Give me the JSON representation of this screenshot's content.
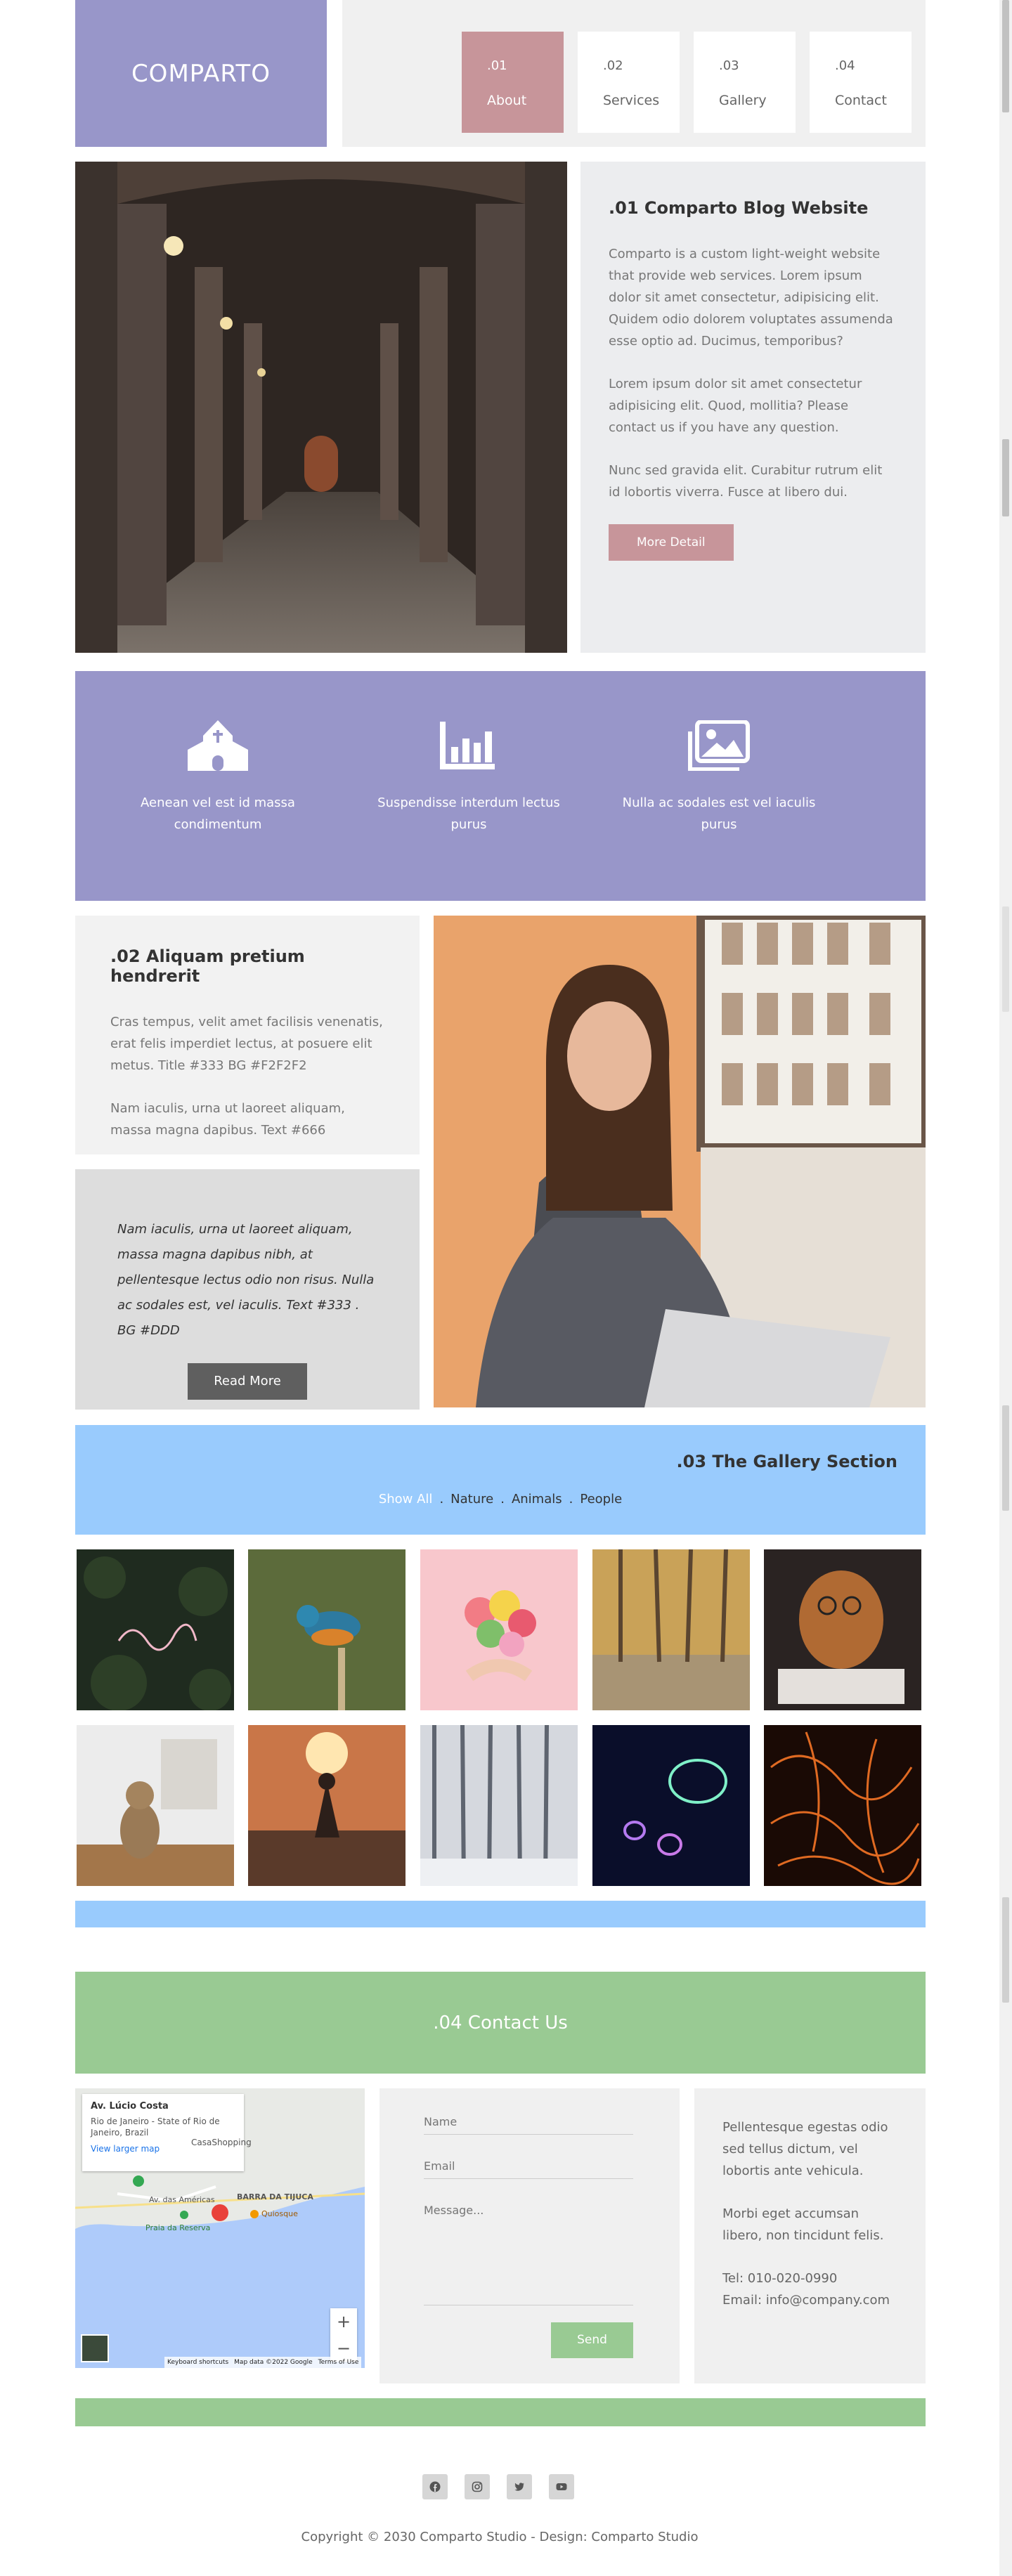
{
  "brand": {
    "logo": "COMPARTO"
  },
  "nav": [
    {
      "num": ".01",
      "label": "About",
      "active": true
    },
    {
      "num": ".02",
      "label": "Services",
      "active": false
    },
    {
      "num": ".03",
      "label": "Gallery",
      "active": false
    },
    {
      "num": ".04",
      "label": "Contact",
      "active": false
    }
  ],
  "about": {
    "title": ".01 Comparto Blog Website",
    "p1": "Comparto is a custom light-weight website that provide web services. Lorem ipsum dolor sit amet consectetur, adipisicing elit. Quidem odio dolorem voluptates assumenda esse optio ad. Ducimus, temporibus?",
    "p2": "Lorem ipsum dolor sit amet consectetur adipisicing elit. Quod, mollitia? Please contact us if you have any question.",
    "p3": "Nunc sed gravida elit. Curabitur rutrum elit id lobortis viverra. Fusce at libero dui.",
    "button": "More Detail"
  },
  "features": [
    {
      "icon": "church-icon",
      "text": "Aenean vel est id massa condimentum"
    },
    {
      "icon": "bar-chart-icon",
      "text": "Suspendisse interdum lectus purus"
    },
    {
      "icon": "images-icon",
      "text": "Nulla ac sodales est vel iaculis purus"
    }
  ],
  "services": {
    "title": ".02 Aliquam pretium hendrerit",
    "p1": "Cras tempus, velit amet facilisis venenatis, erat felis imperdiet lectus, at posuere elit metus. Title #333 BG #F2F2F2",
    "p2": "Nam iaculis, urna ut laoreet aliquam, massa magna dapibus. Text #666",
    "quote": "Nam iaculis, urna ut laoreet aliquam, massa magna dapibus nibh, at pellentesque lectus odio non risus. Nulla ac sodales est, vel iaculis. Text #333 . BG #DDD",
    "button": "Read More"
  },
  "gallery": {
    "title": ".03 The Gallery Section",
    "filters": [
      "Show All",
      "Nature",
      "Animals",
      "People"
    ],
    "active_filter": "Show All",
    "tiles": [
      "neon-breathe",
      "kingfisher",
      "flower-heart",
      "autumn-forest",
      "dog-glasses",
      "cat-kitchen",
      "meditation-sunset",
      "snowy-forest",
      "jellyfish",
      "lava-sparks"
    ]
  },
  "contact": {
    "title": ".04 Contact Us",
    "map": {
      "place": "Av. Lúcio Costa",
      "address": "Rio de Janeiro - State of Rio de Janeiro, Brazil",
      "link": "View larger map",
      "footer": [
        "Keyboard shortcuts",
        "Map data ©2022 Google",
        "Terms of Use"
      ],
      "labels": [
        "BARRA DA TIJUCA",
        "Av. das Américas",
        "CasaShopping",
        "Praia da Reserva",
        "Quiosque"
      ]
    },
    "form": {
      "name_ph": "Name",
      "email_ph": "Email",
      "message_ph": "Message...",
      "send": "Send"
    },
    "info": {
      "p1": "Pellentesque egestas odio sed tellus dictum, vel lobortis ante vehicula.",
      "p2": "Morbi eget accumsan libero, non tincidunt felis.",
      "tel": "Tel: 010-020-0990",
      "email": "Email: info@company.com"
    }
  },
  "footer": {
    "social": [
      "facebook-icon",
      "instagram-icon",
      "twitter-icon",
      "youtube-icon"
    ],
    "copyright": "Copyright © 2030 Comparto Studio - Design: Comparto Studio"
  }
}
